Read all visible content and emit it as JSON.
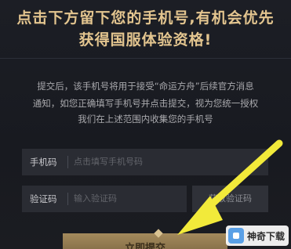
{
  "heading": {
    "line1": "点击下方留下您的手机号,有机会优先",
    "line2": "获得国服体验资格!"
  },
  "notice": {
    "line1": "提交后，该手机号将用于接受“命运方舟”后续官方消息",
    "line2": "通知，如您正确填写手机号并点击提交，视为您统一授权",
    "line3": "我们在上述范围内收集您的手机号"
  },
  "form": {
    "phone_label": "手机码",
    "phone_placeholder": "点击填写手机号码",
    "code_label": "验证码",
    "code_placeholder": "输入验证码",
    "send_code_label": "获取验证码",
    "submit_label": "立即提交"
  },
  "colors": {
    "heading": "#e3c58f",
    "background": "#1a1c22",
    "input_bg": "#2a2c33",
    "arrow": "#f2ea3a",
    "button_gold": "#a48a5c"
  },
  "watermark": {
    "text": "神奇下载",
    "icon": "app-logo-icon"
  },
  "annotation": {
    "icon": "arrow-pointer-icon"
  }
}
